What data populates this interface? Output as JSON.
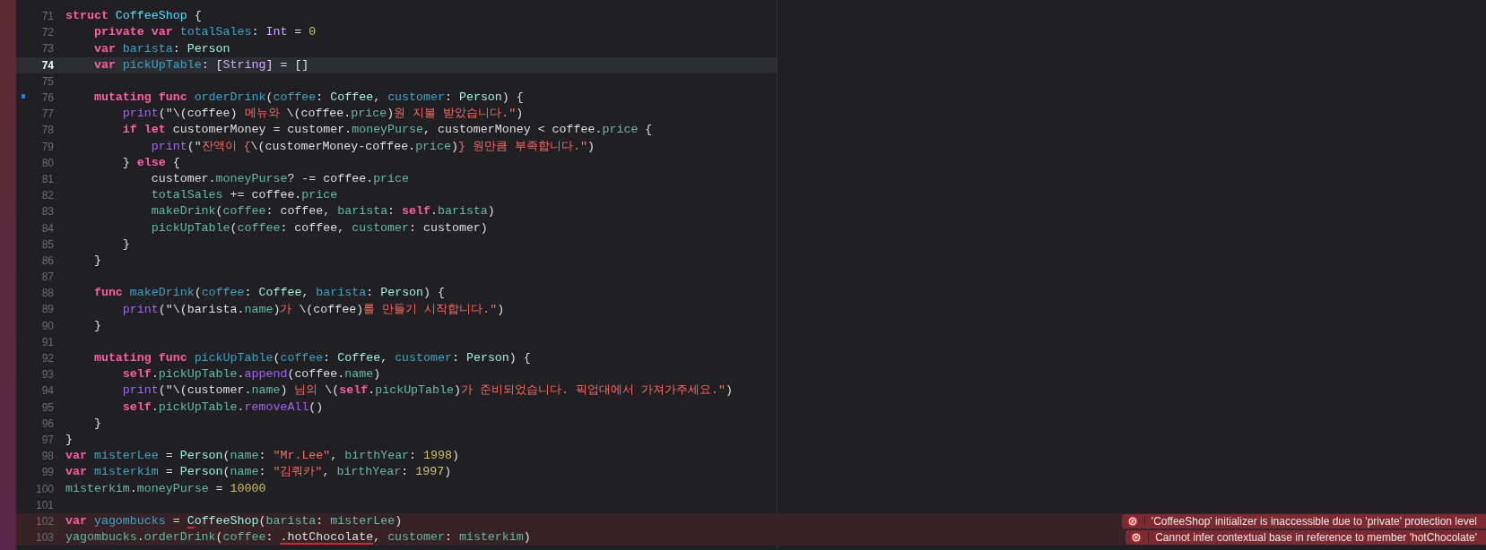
{
  "editor": {
    "lines": [
      {
        "number": "71",
        "current": false,
        "error": false,
        "marker": false,
        "tokens": [
          {
            "text": "struct ",
            "kind": "keyword"
          },
          {
            "text": "CoffeeShop",
            "kind": "typedecl"
          },
          {
            "text": " {",
            "kind": "plain"
          }
        ]
      },
      {
        "number": "72",
        "current": false,
        "error": false,
        "marker": false,
        "tokens": [
          {
            "text": "    private var ",
            "kind": "keyword"
          },
          {
            "text": "totalSales",
            "kind": "decl"
          },
          {
            "text": ": ",
            "kind": "plain"
          },
          {
            "text": "Int",
            "kind": "systype"
          },
          {
            "text": " = ",
            "kind": "plain"
          },
          {
            "text": "0",
            "kind": "number"
          }
        ]
      },
      {
        "number": "73",
        "current": false,
        "error": false,
        "marker": false,
        "tokens": [
          {
            "text": "    var ",
            "kind": "keyword"
          },
          {
            "text": "barista",
            "kind": "decl"
          },
          {
            "text": ": ",
            "kind": "plain"
          },
          {
            "text": "Person",
            "kind": "type"
          }
        ]
      },
      {
        "number": "74",
        "current": true,
        "error": false,
        "marker": false,
        "tokens": [
          {
            "text": "    var ",
            "kind": "keyword"
          },
          {
            "text": "pickUpTable",
            "kind": "decl"
          },
          {
            "text": ": [",
            "kind": "plain"
          },
          {
            "text": "String",
            "kind": "systype"
          },
          {
            "text": "] = []",
            "kind": "plain"
          }
        ]
      },
      {
        "number": "75",
        "current": false,
        "error": false,
        "marker": false
      },
      {
        "number": "76",
        "current": false,
        "error": false,
        "marker": true,
        "tokens": [
          {
            "text": "    mutating func ",
            "kind": "keyword"
          },
          {
            "text": "orderDrink",
            "kind": "decl"
          },
          {
            "text": "(",
            "kind": "plain"
          },
          {
            "text": "coffee",
            "kind": "decl"
          },
          {
            "text": ": ",
            "kind": "plain"
          },
          {
            "text": "Coffee",
            "kind": "type"
          },
          {
            "text": ", ",
            "kind": "plain"
          },
          {
            "text": "customer",
            "kind": "decl"
          },
          {
            "text": ": ",
            "kind": "plain"
          },
          {
            "text": "Person",
            "kind": "type"
          },
          {
            "text": ") {",
            "kind": "plain"
          }
        ]
      },
      {
        "number": "77",
        "current": false,
        "error": false,
        "marker": false,
        "tokens": [
          {
            "text": "        print",
            "kind": "sysfunc"
          },
          {
            "text": "(\"\\(coffee) ",
            "kind": "plain"
          },
          {
            "text": "메뉴와 ",
            "kind": "string"
          },
          {
            "text": "\\(coffee.",
            "kind": "plain"
          },
          {
            "text": "price",
            "kind": "member"
          },
          {
            "text": ")",
            "kind": "plain"
          },
          {
            "text": "원 지불 받았습니다.\"",
            "kind": "string"
          },
          {
            "text": ")",
            "kind": "plain"
          }
        ]
      },
      {
        "number": "78",
        "current": false,
        "error": false,
        "marker": false,
        "tokens": [
          {
            "text": "        if let",
            "kind": "keyword"
          },
          {
            "text": " customerMoney = customer.",
            "kind": "plain"
          },
          {
            "text": "moneyPurse",
            "kind": "member"
          },
          {
            "text": ", customerMoney < coffee.",
            "kind": "plain"
          },
          {
            "text": "price",
            "kind": "member"
          },
          {
            "text": " {",
            "kind": "plain"
          }
        ]
      },
      {
        "number": "79",
        "current": false,
        "error": false,
        "marker": false,
        "tokens": [
          {
            "text": "            print",
            "kind": "sysfunc"
          },
          {
            "text": "(\"",
            "kind": "plain"
          },
          {
            "text": "잔액이 {",
            "kind": "string"
          },
          {
            "text": "\\(customerMoney-coffee.",
            "kind": "plain"
          },
          {
            "text": "price",
            "kind": "member"
          },
          {
            "text": ")",
            "kind": "plain"
          },
          {
            "text": "} 원만큼 부족합니다.\"",
            "kind": "string"
          },
          {
            "text": ")",
            "kind": "plain"
          }
        ]
      },
      {
        "number": "80",
        "current": false,
        "error": false,
        "marker": false,
        "tokens": [
          {
            "text": "        } ",
            "kind": "plain"
          },
          {
            "text": "else",
            "kind": "keyword"
          },
          {
            "text": " {",
            "kind": "plain"
          }
        ]
      },
      {
        "number": "81",
        "current": false,
        "error": false,
        "marker": false,
        "tokens": [
          {
            "text": "            customer.",
            "kind": "plain"
          },
          {
            "text": "moneyPurse",
            "kind": "member"
          },
          {
            "text": "? -= coffee.",
            "kind": "plain"
          },
          {
            "text": "price",
            "kind": "member"
          }
        ]
      },
      {
        "number": "82",
        "current": false,
        "error": false,
        "marker": false,
        "tokens": [
          {
            "text": "            totalSales",
            "kind": "member"
          },
          {
            "text": " += coffee.",
            "kind": "plain"
          },
          {
            "text": "price",
            "kind": "member"
          }
        ]
      },
      {
        "number": "83",
        "current": false,
        "error": false,
        "marker": false,
        "tokens": [
          {
            "text": "            makeDrink",
            "kind": "member"
          },
          {
            "text": "(",
            "kind": "plain"
          },
          {
            "text": "coffee",
            "kind": "member"
          },
          {
            "text": ": coffee, ",
            "kind": "plain"
          },
          {
            "text": "barista",
            "kind": "member"
          },
          {
            "text": ": ",
            "kind": "plain"
          },
          {
            "text": "self",
            "kind": "keyword"
          },
          {
            "text": ".",
            "kind": "plain"
          },
          {
            "text": "barista",
            "kind": "member"
          },
          {
            "text": ")",
            "kind": "plain"
          }
        ]
      },
      {
        "number": "84",
        "current": false,
        "error": false,
        "marker": false,
        "tokens": [
          {
            "text": "            pickUpTable",
            "kind": "member"
          },
          {
            "text": "(",
            "kind": "plain"
          },
          {
            "text": "coffee",
            "kind": "member"
          },
          {
            "text": ": coffee, ",
            "kind": "plain"
          },
          {
            "text": "customer",
            "kind": "member"
          },
          {
            "text": ": customer)",
            "kind": "plain"
          }
        ]
      },
      {
        "number": "85",
        "current": false,
        "error": false,
        "marker": false,
        "tokens": [
          {
            "text": "        }",
            "kind": "plain"
          }
        ]
      },
      {
        "number": "86",
        "current": false,
        "error": false,
        "marker": false,
        "tokens": [
          {
            "text": "    }",
            "kind": "plain"
          }
        ]
      },
      {
        "number": "87",
        "current": false,
        "error": false,
        "marker": false
      },
      {
        "number": "88",
        "current": false,
        "error": false,
        "marker": false,
        "tokens": [
          {
            "text": "    func ",
            "kind": "keyword"
          },
          {
            "text": "makeDrink",
            "kind": "decl"
          },
          {
            "text": "(",
            "kind": "plain"
          },
          {
            "text": "coffee",
            "kind": "decl"
          },
          {
            "text": ": ",
            "kind": "plain"
          },
          {
            "text": "Coffee",
            "kind": "type"
          },
          {
            "text": ", ",
            "kind": "plain"
          },
          {
            "text": "barista",
            "kind": "decl"
          },
          {
            "text": ": ",
            "kind": "plain"
          },
          {
            "text": "Person",
            "kind": "type"
          },
          {
            "text": ") {",
            "kind": "plain"
          }
        ]
      },
      {
        "number": "89",
        "current": false,
        "error": false,
        "marker": false,
        "tokens": [
          {
            "text": "        print",
            "kind": "sysfunc"
          },
          {
            "text": "(\"\\(barista.",
            "kind": "plain"
          },
          {
            "text": "name",
            "kind": "member"
          },
          {
            "text": ")",
            "kind": "plain"
          },
          {
            "text": "가 ",
            "kind": "string"
          },
          {
            "text": "\\(coffee)",
            "kind": "plain"
          },
          {
            "text": "를 만들기 시작합니다.\"",
            "kind": "string"
          },
          {
            "text": ")",
            "kind": "plain"
          }
        ]
      },
      {
        "number": "90",
        "current": false,
        "error": false,
        "marker": false,
        "tokens": [
          {
            "text": "    }",
            "kind": "plain"
          }
        ]
      },
      {
        "number": "91",
        "current": false,
        "error": false,
        "marker": false
      },
      {
        "number": "92",
        "current": false,
        "error": false,
        "marker": false,
        "tokens": [
          {
            "text": "    mutating func ",
            "kind": "keyword"
          },
          {
            "text": "pickUpTable",
            "kind": "decl"
          },
          {
            "text": "(",
            "kind": "plain"
          },
          {
            "text": "coffee",
            "kind": "decl"
          },
          {
            "text": ": ",
            "kind": "plain"
          },
          {
            "text": "Coffee",
            "kind": "type"
          },
          {
            "text": ", ",
            "kind": "plain"
          },
          {
            "text": "customer",
            "kind": "decl"
          },
          {
            "text": ": ",
            "kind": "plain"
          },
          {
            "text": "Person",
            "kind": "type"
          },
          {
            "text": ") {",
            "kind": "plain"
          }
        ]
      },
      {
        "number": "93",
        "current": false,
        "error": false,
        "marker": false,
        "tokens": [
          {
            "text": "        self",
            "kind": "keyword"
          },
          {
            "text": ".",
            "kind": "plain"
          },
          {
            "text": "pickUpTable",
            "kind": "member"
          },
          {
            "text": ".",
            "kind": "plain"
          },
          {
            "text": "append",
            "kind": "sysfunc"
          },
          {
            "text": "(coffee.",
            "kind": "plain"
          },
          {
            "text": "name",
            "kind": "member"
          },
          {
            "text": ")",
            "kind": "plain"
          }
        ]
      },
      {
        "number": "94",
        "current": false,
        "error": false,
        "marker": false,
        "tokens": [
          {
            "text": "        print",
            "kind": "sysfunc"
          },
          {
            "text": "(\"\\(customer.",
            "kind": "plain"
          },
          {
            "text": "name",
            "kind": "member"
          },
          {
            "text": ") ",
            "kind": "plain"
          },
          {
            "text": "님의 ",
            "kind": "string"
          },
          {
            "text": "\\(",
            "kind": "plain"
          },
          {
            "text": "self",
            "kind": "keyword"
          },
          {
            "text": ".",
            "kind": "plain"
          },
          {
            "text": "pickUpTable",
            "kind": "member"
          },
          {
            "text": ")",
            "kind": "plain"
          },
          {
            "text": "가 준비되었습니다. 픽업대에서 가져가주세요.\"",
            "kind": "string"
          },
          {
            "text": ")",
            "kind": "plain"
          }
        ]
      },
      {
        "number": "95",
        "current": false,
        "error": false,
        "marker": false,
        "tokens": [
          {
            "text": "        self",
            "kind": "keyword"
          },
          {
            "text": ".",
            "kind": "plain"
          },
          {
            "text": "pickUpTable",
            "kind": "member"
          },
          {
            "text": ".",
            "kind": "plain"
          },
          {
            "text": "removeAll",
            "kind": "sysfunc"
          },
          {
            "text": "()",
            "kind": "plain"
          }
        ]
      },
      {
        "number": "96",
        "current": false,
        "error": false,
        "marker": false,
        "tokens": [
          {
            "text": "    }",
            "kind": "plain"
          }
        ]
      },
      {
        "number": "97",
        "current": false,
        "error": false,
        "marker": false,
        "tokens": [
          {
            "text": "}",
            "kind": "plain"
          }
        ]
      },
      {
        "number": "98",
        "current": false,
        "error": false,
        "marker": false,
        "tokens": [
          {
            "text": "var ",
            "kind": "keyword"
          },
          {
            "text": "misterLee",
            "kind": "decl"
          },
          {
            "text": " = ",
            "kind": "plain"
          },
          {
            "text": "Person",
            "kind": "type"
          },
          {
            "text": "(",
            "kind": "plain"
          },
          {
            "text": "name",
            "kind": "member"
          },
          {
            "text": ": ",
            "kind": "plain"
          },
          {
            "text": "\"Mr.Lee\"",
            "kind": "string"
          },
          {
            "text": ", ",
            "kind": "plain"
          },
          {
            "text": "birthYear",
            "kind": "member"
          },
          {
            "text": ": ",
            "kind": "plain"
          },
          {
            "text": "1998",
            "kind": "number"
          },
          {
            "text": ")",
            "kind": "plain"
          }
        ]
      },
      {
        "number": "99",
        "current": false,
        "error": false,
        "marker": false,
        "tokens": [
          {
            "text": "var ",
            "kind": "keyword"
          },
          {
            "text": "misterkim",
            "kind": "decl"
          },
          {
            "text": " = ",
            "kind": "plain"
          },
          {
            "text": "Person",
            "kind": "type"
          },
          {
            "text": "(",
            "kind": "plain"
          },
          {
            "text": "name",
            "kind": "member"
          },
          {
            "text": ": ",
            "kind": "plain"
          },
          {
            "text": "\"김쿼카\"",
            "kind": "string"
          },
          {
            "text": ", ",
            "kind": "plain"
          },
          {
            "text": "birthYear",
            "kind": "member"
          },
          {
            "text": ": ",
            "kind": "plain"
          },
          {
            "text": "1997",
            "kind": "number"
          },
          {
            "text": ")",
            "kind": "plain"
          }
        ]
      },
      {
        "number": "100",
        "current": false,
        "error": false,
        "marker": false,
        "tokens": [
          {
            "text": "misterkim",
            "kind": "member"
          },
          {
            "text": ".",
            "kind": "plain"
          },
          {
            "text": "moneyPurse",
            "kind": "member"
          },
          {
            "text": " = ",
            "kind": "plain"
          },
          {
            "text": "10000",
            "kind": "number"
          }
        ]
      },
      {
        "number": "101",
        "current": false,
        "error": false,
        "marker": false
      },
      {
        "number": "102",
        "current": false,
        "error": true,
        "marker": false,
        "tokens": [
          {
            "text": "var ",
            "kind": "keyword"
          },
          {
            "text": "yagombucks",
            "kind": "decl"
          },
          {
            "text": " = ",
            "kind": "plain"
          },
          {
            "text": "C",
            "kind": "flaggedtype"
          },
          {
            "text": "offeeShop",
            "kind": "type"
          },
          {
            "text": "(",
            "kind": "plain"
          },
          {
            "text": "barista",
            "kind": "member"
          },
          {
            "text": ": ",
            "kind": "plain"
          },
          {
            "text": "misterLee",
            "kind": "member"
          },
          {
            "text": ")",
            "kind": "plain"
          }
        ],
        "issue": {
          "message": "'CoffeeShop' initializer is inaccessible due to 'private' protection level"
        }
      },
      {
        "number": "103",
        "current": false,
        "error": true,
        "marker": false,
        "tokens": [
          {
            "text": "yagombucks",
            "kind": "member"
          },
          {
            "text": ".",
            "kind": "plain"
          },
          {
            "text": "orderDrink",
            "kind": "member"
          },
          {
            "text": "(",
            "kind": "plain"
          },
          {
            "text": "coffee",
            "kind": "member"
          },
          {
            "text": ": ",
            "kind": "plain"
          },
          {
            "text": ".hotChocolate",
            "kind": "flaggedplain"
          },
          {
            "text": ", ",
            "kind": "plain"
          },
          {
            "text": "customer",
            "kind": "member"
          },
          {
            "text": ": ",
            "kind": "plain"
          },
          {
            "text": "misterkim",
            "kind": "member"
          },
          {
            "text": ")",
            "kind": "plain"
          }
        ],
        "issue": {
          "message": "Cannot infer contextual base in reference to member 'hotChocolate'"
        }
      }
    ]
  }
}
